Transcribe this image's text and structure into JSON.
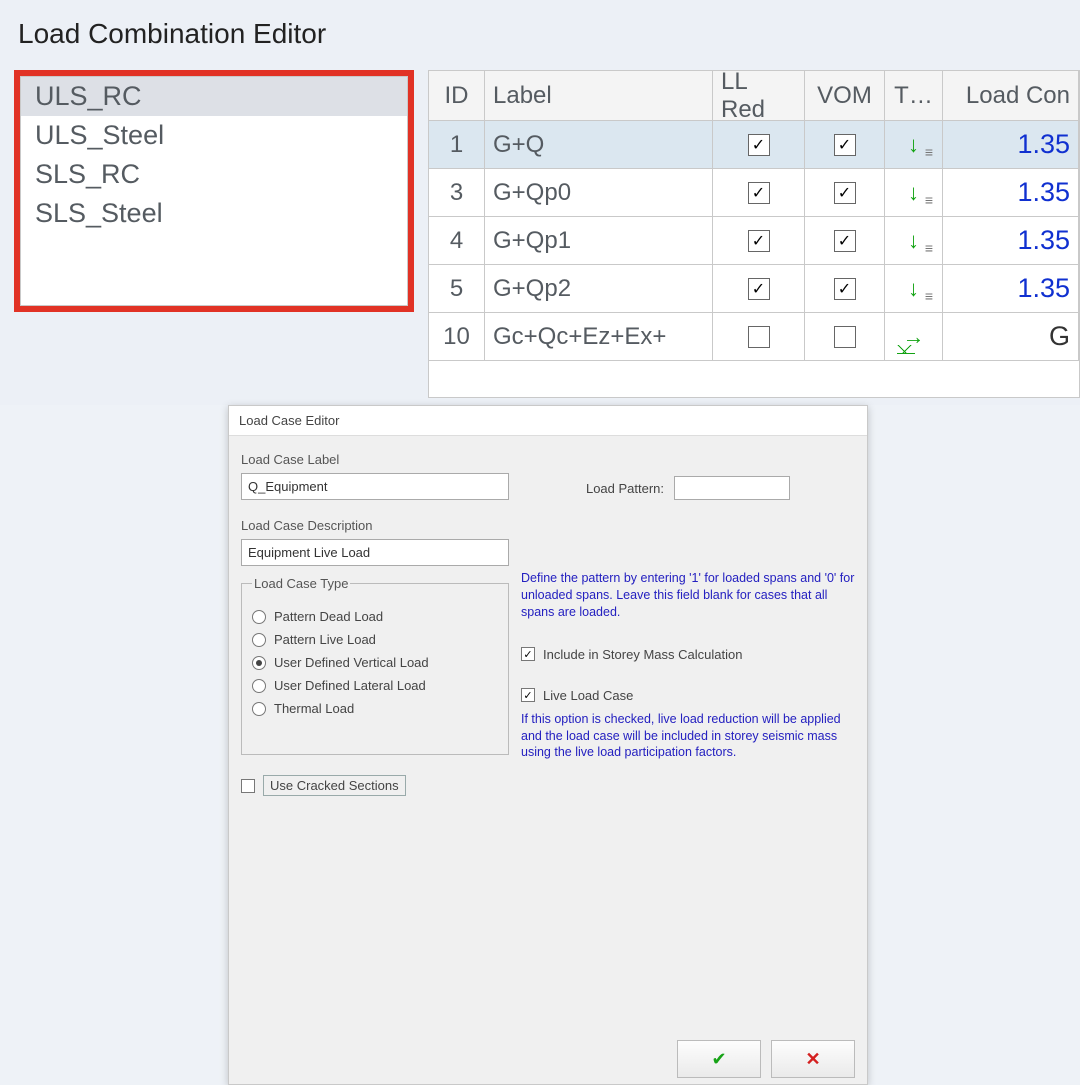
{
  "topWindow": {
    "title": "Load Combination Editor",
    "listItems": [
      "ULS_RC",
      "ULS_Steel",
      "SLS_RC",
      "SLS_Steel"
    ],
    "selectedIndex": 0,
    "grid": {
      "headers": {
        "id": "ID",
        "label": "Label",
        "ll": "LL Red",
        "vom": "VOM",
        "t": "T…",
        "lc": "Load Con"
      },
      "rows": [
        {
          "id": "1",
          "label": "G+Q",
          "ll": true,
          "vom": true,
          "ticon": "down",
          "lc": "1.35",
          "sel": true
        },
        {
          "id": "3",
          "label": "G+Qp0",
          "ll": true,
          "vom": true,
          "ticon": "down",
          "lc": "1.35"
        },
        {
          "id": "4",
          "label": "G+Qp1",
          "ll": true,
          "vom": true,
          "ticon": "down",
          "lc": "1.35"
        },
        {
          "id": "5",
          "label": "G+Qp2",
          "ll": true,
          "vom": true,
          "ticon": "down",
          "lc": "1.35"
        },
        {
          "id": "10",
          "label": "Gc+Qc+Ez+Ex+",
          "ll": false,
          "vom": false,
          "ticon": "right",
          "lc": "G",
          "lcColor": "#333"
        }
      ]
    }
  },
  "dialog": {
    "title": "Load Case Editor",
    "left": {
      "labelTitle": "Load Case Label",
      "labelValue": "Q_Equipment",
      "descTitle": "Load Case Description",
      "descValue": "Equipment Live Load",
      "typeGroup": "Load Case Type",
      "radios": [
        {
          "label": "Pattern Dead Load",
          "on": false
        },
        {
          "label": "Pattern Live Load",
          "on": false
        },
        {
          "label": "User Defined Vertical Load",
          "on": true
        },
        {
          "label": "User Defined Lateral Load",
          "on": false
        },
        {
          "label": "Thermal Load",
          "on": false
        }
      ],
      "crackedChk": false,
      "crackedLabel": "Use Cracked Sections"
    },
    "right": {
      "patternLabel": "Load Pattern:",
      "patternHelp": "Define the pattern by entering '1' for loaded spans and '0' for unloaded spans. Leave this field blank for cases that all spans are loaded.",
      "storeyChk": true,
      "storeyLabel": "Include in Storey Mass Calculation",
      "liveChk": true,
      "liveLabel": "Live Load Case",
      "liveHelp": "If this option is checked, live load reduction will be applied and the load case will be included in storey seismic mass using the live load participation factors."
    },
    "buttons": {
      "ok": "OK",
      "cancel": "Cancel"
    }
  }
}
